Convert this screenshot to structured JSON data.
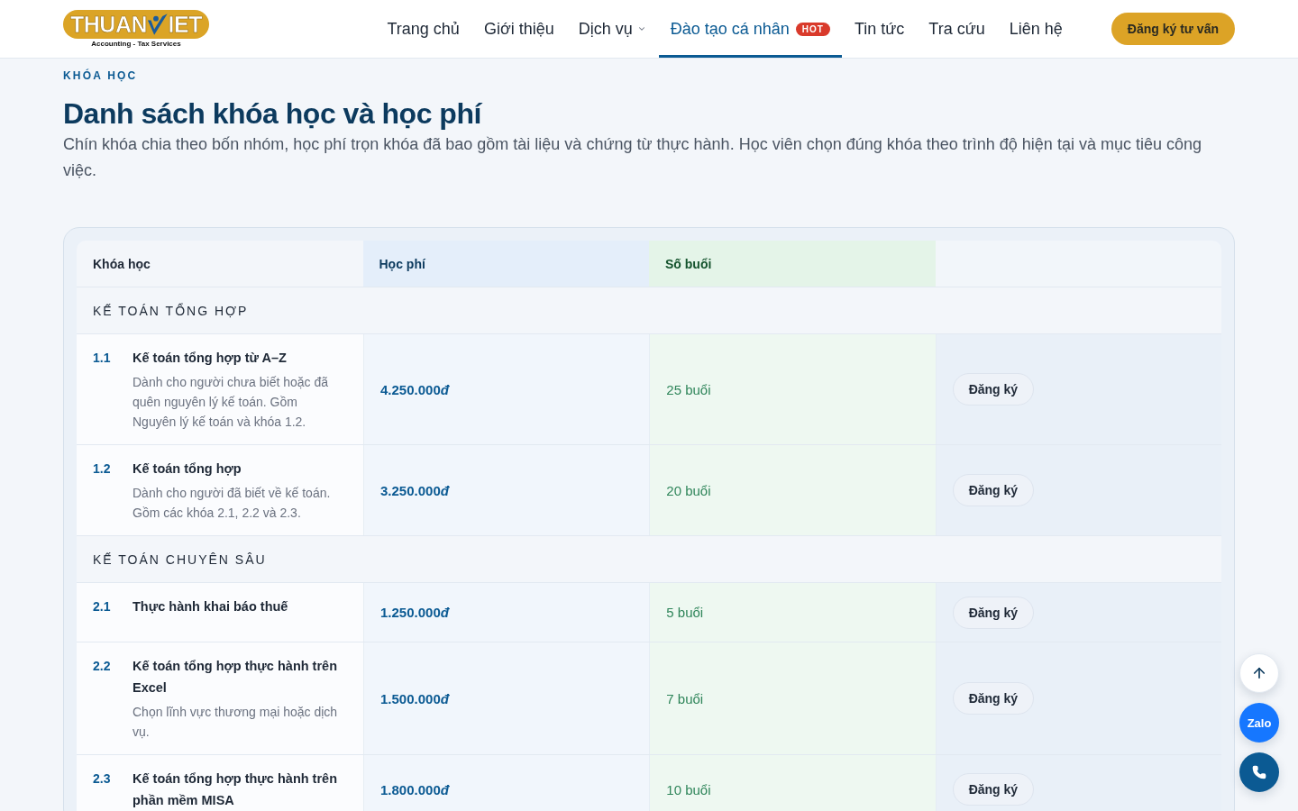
{
  "header": {
    "logo": {
      "wordmark": [
        "THUAN",
        "IET"
      ],
      "tagline": "Accounting - Tax Services"
    },
    "nav": [
      {
        "label": "Trang chủ",
        "selected": false,
        "has_menu": false
      },
      {
        "label": "Giới thiệu",
        "selected": false,
        "has_menu": false
      },
      {
        "label": "Dịch vụ",
        "selected": false,
        "has_menu": true
      },
      {
        "label": "Đào tạo cá nhân",
        "selected": true,
        "has_menu": false,
        "badge": "HOT"
      },
      {
        "label": "Tin tức",
        "selected": false,
        "has_menu": false
      },
      {
        "label": "Tra cứu",
        "selected": false,
        "has_menu": false
      },
      {
        "label": "Liên hệ",
        "selected": false,
        "has_menu": false
      }
    ],
    "cta": "Đăng ký tư vấn"
  },
  "intro": {
    "eyebrow": "KHÓA HỌC",
    "title": "Danh sách khóa học và học phí",
    "description": "Chín khóa chia theo bốn nhóm, học phí trọn khóa đã bao gồm tài liệu và chứng từ thực hành. Học viên chọn đúng khóa theo trình độ hiện tại và mục tiêu công việc."
  },
  "table": {
    "columns": [
      "Khóa học",
      "Học phí",
      "Số buổi"
    ],
    "groups": [
      {
        "title": "KẾ TOÁN TỔNG HỢP",
        "courses": [
          {
            "number": "1.1",
            "title": "Kế toán tổng hợp từ A–Z",
            "description": "Dành cho người chưa biết hoặc đã quên nguyên lý kế toán. Gồm Nguyên lý kế toán và khóa 1.2.",
            "fee": "4.250.000",
            "currency": "đ",
            "sessions": "25 buổi",
            "action": "Đăng ký"
          },
          {
            "number": "1.2",
            "title": "Kế toán tổng hợp",
            "description": "Dành cho người đã biết về kế toán. Gồm các khóa 2.1, 2.2 và 2.3.",
            "fee": "3.250.000",
            "currency": "đ",
            "sessions": "20 buổi",
            "action": "Đăng ký"
          }
        ]
      },
      {
        "title": "KẾ TOÁN CHUYÊN SÂU",
        "courses": [
          {
            "number": "2.1",
            "title": "Thực hành khai báo thuế",
            "fee": "1.250.000",
            "currency": "đ",
            "sessions": "5 buổi",
            "action": "Đăng ký"
          },
          {
            "number": "2.2",
            "title": "Kế toán tổng hợp thực hành trên Excel",
            "description": "Chọn lĩnh vực thương mại hoặc dịch vụ.",
            "fee": "1.500.000",
            "currency": "đ",
            "sessions": "7 buổi",
            "action": "Đăng ký"
          },
          {
            "number": "2.3",
            "title": "Kế toán tổng hợp thực hành trên phần mềm MISA",
            "fee": "1.800.000",
            "currency": "đ",
            "sessions": "10 buổi",
            "action": "Đăng ký"
          }
        ]
      }
    ]
  },
  "floating_actions": [
    {
      "kind": "scroll_top"
    },
    {
      "kind": "zalo",
      "label": "Zalo"
    },
    {
      "kind": "call"
    }
  ]
}
